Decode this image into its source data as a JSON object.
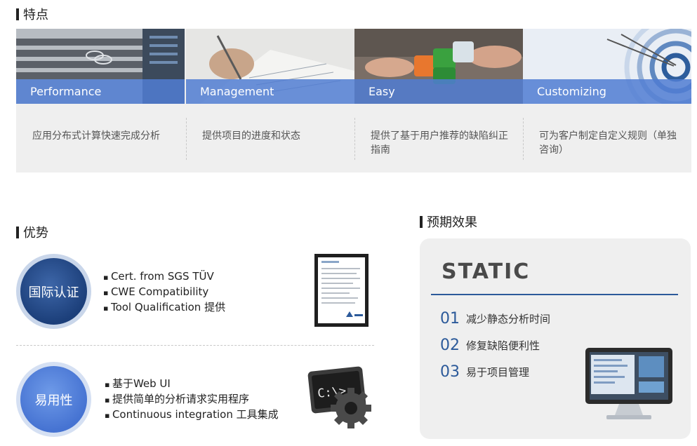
{
  "features_section": {
    "title": "特点"
  },
  "features": [
    {
      "label": "Performance",
      "desc": "应用分布式计算快速完成分析"
    },
    {
      "label": "Management",
      "desc": "提供项目的进度和状态"
    },
    {
      "label": "Easy",
      "desc": "提供了基于用户推荐的缺陷纠正指南"
    },
    {
      "label": "Customizing",
      "desc": "可为客户制定自定义规则（单独咨询）"
    }
  ],
  "advantages_section": {
    "title": "优势"
  },
  "advantages": [
    {
      "badge": "国际认证",
      "items": [
        "Cert. from SGS TÜV",
        "CWE Compatibility",
        "Tool Qualification 提供"
      ],
      "icon": "certificate-icon"
    },
    {
      "badge": "易用性",
      "items": [
        "基于Web UI",
        "提供简单的分析请求实用程序",
        "Continuous integration 工具集成"
      ],
      "icon": "terminal-gear-icon"
    }
  ],
  "effects_section": {
    "title": "预期效果"
  },
  "effects": {
    "heading": "STATIC",
    "items": [
      {
        "num": "01",
        "text": "减少静态分析时间"
      },
      {
        "num": "02",
        "text": "修复缺陷便利性"
      },
      {
        "num": "03",
        "text": "易于项目管理"
      }
    ],
    "icon": "monitor-icon"
  },
  "colors": {
    "accent": "#2c5a9a",
    "label_overlay": "#507dd2",
    "badge_dark": "#1c3f7a",
    "badge_light": "#4673d2"
  }
}
